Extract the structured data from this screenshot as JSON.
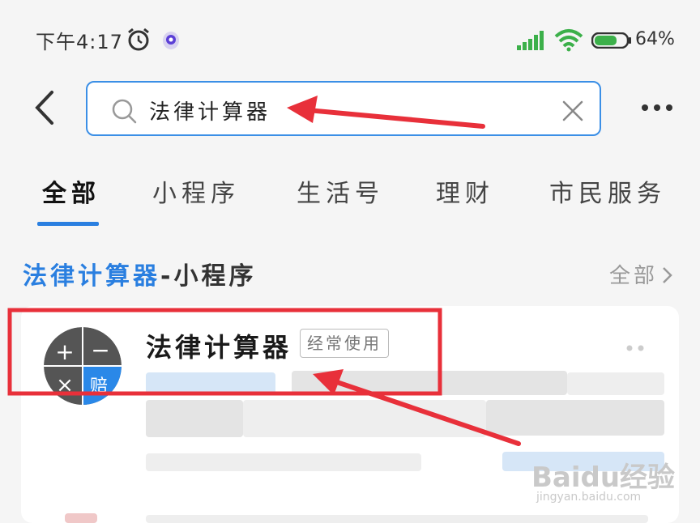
{
  "status_bar": {
    "time": "下午4:17",
    "battery": "64%",
    "icons": [
      "alarm-icon",
      "app-icon",
      "signal-icon",
      "wifi-icon",
      "battery-icon"
    ]
  },
  "search": {
    "query": "法律计算器",
    "icons": [
      "back-icon",
      "search-icon",
      "clear-icon",
      "more-icon"
    ]
  },
  "tabs": [
    {
      "label": "全部",
      "active": true
    },
    {
      "label": "小程序",
      "active": false
    },
    {
      "label": "生活号",
      "active": false
    },
    {
      "label": "理财",
      "active": false
    },
    {
      "label": "市民服务",
      "active": false
    }
  ],
  "section": {
    "highlight": "法律计算器",
    "rest": "-小程序",
    "more_label": "全部"
  },
  "result": {
    "title": "法律计算器",
    "badge": "经常使用",
    "avatar_glyphs": [
      "+",
      "−",
      "×",
      "赔"
    ]
  },
  "watermark": {
    "brand": "Baidu经验",
    "url": "jingyan.baidu.com"
  },
  "colors": {
    "accent": "#2a7fe0",
    "search_border": "#3b8fe6",
    "annotation": "#e8303a",
    "avatar_dark": "#555555",
    "avatar_blue": "#2a88e8"
  }
}
